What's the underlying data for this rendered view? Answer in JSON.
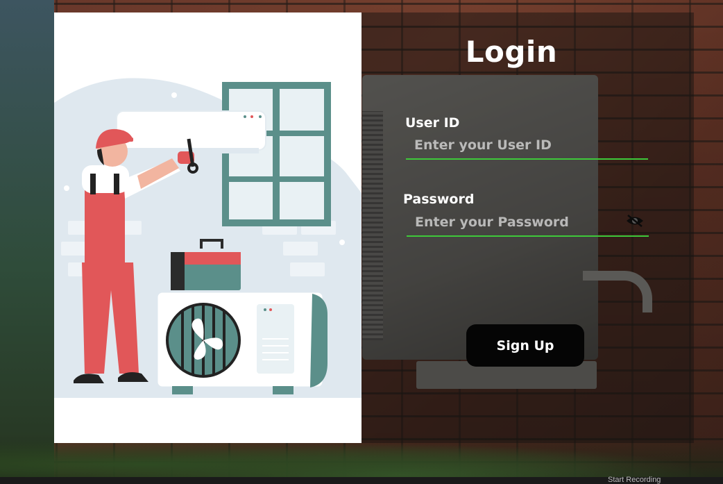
{
  "page": {
    "title": "Login"
  },
  "form": {
    "user_label": "User ID",
    "user_placeholder": "Enter your User ID",
    "user_value": "",
    "password_label": "Password",
    "password_placeholder": "Enter your Password",
    "password_value": "",
    "password_toggle_icon": "eye-slash-icon",
    "submit_label": "Sign Up"
  },
  "taskbar": {
    "partial_text": "Start Recording"
  },
  "colors": {
    "accent_underline": "#3ec93a",
    "button_bg": "#050505",
    "illustration_bg": "#ffffff",
    "worker_red": "#e15759",
    "unit_teal": "#5b8f8a"
  }
}
